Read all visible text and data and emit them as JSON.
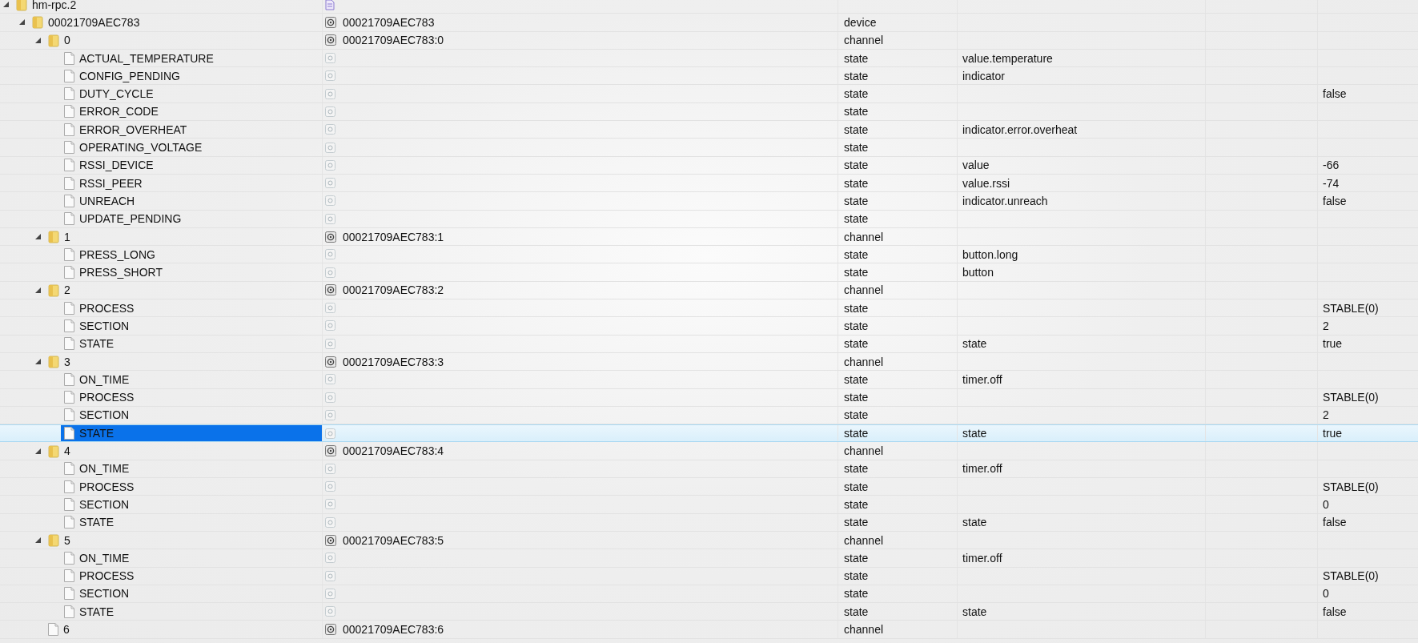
{
  "tree": [
    {
      "name": "hm-rpc.2",
      "kind": "adapter",
      "expanded": true,
      "selected": false,
      "children": [
        {
          "name": "00021709AEC783",
          "kind": "object",
          "id": "00021709AEC783",
          "type": "device",
          "expanded": true,
          "selected": false,
          "children": [
            {
              "name": "0",
              "kind": "object",
              "id": "00021709AEC783:0",
              "type": "channel",
              "expanded": true,
              "selected": false,
              "children": [
                {
                  "name": "ACTUAL_TEMPERATURE",
                  "kind": "state",
                  "type": "state",
                  "role": "value.temperature",
                  "selected": false
                },
                {
                  "name": "CONFIG_PENDING",
                  "kind": "state",
                  "type": "state",
                  "role": "indicator",
                  "selected": false
                },
                {
                  "name": "DUTY_CYCLE",
                  "kind": "state",
                  "type": "state",
                  "value": "false",
                  "selected": false
                },
                {
                  "name": "ERROR_CODE",
                  "kind": "state",
                  "type": "state",
                  "selected": false
                },
                {
                  "name": "ERROR_OVERHEAT",
                  "kind": "state",
                  "type": "state",
                  "role": "indicator.error.overheat",
                  "selected": false
                },
                {
                  "name": "OPERATING_VOLTAGE",
                  "kind": "state",
                  "type": "state",
                  "selected": false
                },
                {
                  "name": "RSSI_DEVICE",
                  "kind": "state",
                  "type": "state",
                  "role": "value",
                  "value": "-66",
                  "selected": false
                },
                {
                  "name": "RSSI_PEER",
                  "kind": "state",
                  "type": "state",
                  "role": "value.rssi",
                  "value": "-74",
                  "selected": false
                },
                {
                  "name": "UNREACH",
                  "kind": "state",
                  "type": "state",
                  "role": "indicator.unreach",
                  "value": "false",
                  "selected": false
                },
                {
                  "name": "UPDATE_PENDING",
                  "kind": "state",
                  "type": "state",
                  "selected": false
                }
              ]
            },
            {
              "name": "1",
              "kind": "object",
              "id": "00021709AEC783:1",
              "type": "channel",
              "expanded": true,
              "selected": false,
              "children": [
                {
                  "name": "PRESS_LONG",
                  "kind": "state",
                  "type": "state",
                  "role": "button.long",
                  "selected": false
                },
                {
                  "name": "PRESS_SHORT",
                  "kind": "state",
                  "type": "state",
                  "role": "button",
                  "selected": false
                }
              ]
            },
            {
              "name": "2",
              "kind": "object",
              "id": "00021709AEC783:2",
              "type": "channel",
              "expanded": true,
              "selected": false,
              "children": [
                {
                  "name": "PROCESS",
                  "kind": "state",
                  "type": "state",
                  "value": "STABLE(0)",
                  "selected": false
                },
                {
                  "name": "SECTION",
                  "kind": "state",
                  "type": "state",
                  "value": "2",
                  "selected": false
                },
                {
                  "name": "STATE",
                  "kind": "state",
                  "type": "state",
                  "role": "state",
                  "value": "true",
                  "selected": false
                }
              ]
            },
            {
              "name": "3",
              "kind": "object",
              "id": "00021709AEC783:3",
              "type": "channel",
              "expanded": true,
              "selected": false,
              "children": [
                {
                  "name": "ON_TIME",
                  "kind": "state",
                  "type": "state",
                  "role": "timer.off",
                  "selected": false
                },
                {
                  "name": "PROCESS",
                  "kind": "state",
                  "type": "state",
                  "value": "STABLE(0)",
                  "selected": false
                },
                {
                  "name": "SECTION",
                  "kind": "state",
                  "type": "state",
                  "value": "2",
                  "selected": false
                },
                {
                  "name": "STATE",
                  "kind": "state",
                  "type": "state",
                  "role": "state",
                  "value": "true",
                  "selected": true
                }
              ]
            },
            {
              "name": "4",
              "kind": "object",
              "id": "00021709AEC783:4",
              "type": "channel",
              "expanded": true,
              "selected": false,
              "children": [
                {
                  "name": "ON_TIME",
                  "kind": "state",
                  "type": "state",
                  "role": "timer.off",
                  "selected": false
                },
                {
                  "name": "PROCESS",
                  "kind": "state",
                  "type": "state",
                  "value": "STABLE(0)",
                  "selected": false
                },
                {
                  "name": "SECTION",
                  "kind": "state",
                  "type": "state",
                  "value": "0",
                  "selected": false
                },
                {
                  "name": "STATE",
                  "kind": "state",
                  "type": "state",
                  "role": "state",
                  "value": "false",
                  "selected": false
                }
              ]
            },
            {
              "name": "5",
              "kind": "object",
              "id": "00021709AEC783:5",
              "type": "channel",
              "expanded": true,
              "selected": false,
              "children": [
                {
                  "name": "ON_TIME",
                  "kind": "state",
                  "type": "state",
                  "role": "timer.off",
                  "selected": false
                },
                {
                  "name": "PROCESS",
                  "kind": "state",
                  "type": "state",
                  "value": "STABLE(0)",
                  "selected": false
                },
                {
                  "name": "SECTION",
                  "kind": "state",
                  "type": "state",
                  "value": "0",
                  "selected": false
                },
                {
                  "name": "STATE",
                  "kind": "state",
                  "type": "state",
                  "role": "state",
                  "value": "false",
                  "selected": false
                }
              ]
            },
            {
              "name": "6",
              "kind": "object",
              "id": "00021709AEC783:6",
              "type": "channel",
              "selected": false
            }
          ]
        }
      ]
    }
  ]
}
